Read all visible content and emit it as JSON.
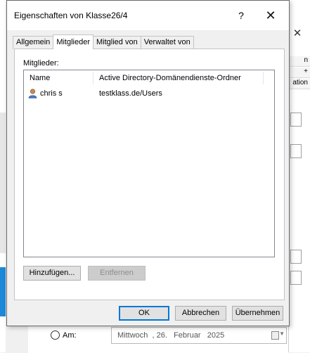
{
  "dialog": {
    "title": "Eigenschaften von Klasse26/4",
    "help_glyph": "?",
    "close_glyph": "✕"
  },
  "tabs": [
    {
      "label": "Allgemein",
      "active": false
    },
    {
      "label": "Mitglieder",
      "active": true
    },
    {
      "label": "Mitglied von",
      "active": false
    },
    {
      "label": "Verwaltet von",
      "active": false
    }
  ],
  "members": {
    "label": "Mitglieder:",
    "columns": {
      "name": "Name",
      "folder": "Active Directory-Domänendienste-Ordner"
    },
    "rows": [
      {
        "name": "chris s",
        "folder": "testklass.de/Users",
        "icon": "user-icon"
      }
    ],
    "add_label": "Hinzufügen...",
    "remove_label": "Entfernen"
  },
  "footer": {
    "ok_label": "OK",
    "cancel_label": "Abbrechen",
    "apply_label": "Übernehmen"
  },
  "background": {
    "close_glyph": "✕",
    "tab_labels": [
      "n",
      "+",
      "ation"
    ],
    "radio_label": "Am:",
    "date_value": "Mittwoch  , 26.   Februar   2025"
  }
}
